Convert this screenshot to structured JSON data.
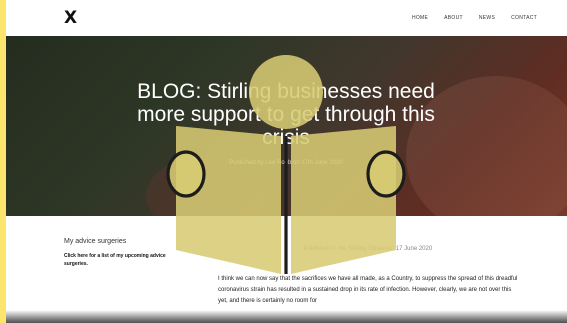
{
  "header": {
    "logo_text": "X",
    "nav": [
      "HOME",
      "ABOUT",
      "NEWS",
      "CONTACT"
    ]
  },
  "hero": {
    "title": "BLOG: Stirling businesses need more support to get through this crisis",
    "meta": "Published by Lee Robb on 17th June 2020"
  },
  "sidebar": {
    "heading": "My advice surgeries",
    "link": "Click here for a list of my upcoming advice surgeries."
  },
  "article": {
    "source": "Published in the Stirling Observer, 17 June 2020",
    "body": "I think we can now say that the sacrifices we have all made, as a Country, to suppress the spread of this dreadful coronavirus strain has resulted in a sustained drop in its rate of infection. However, clearly, we are not over this yet, and there is certainly no room for"
  },
  "overlay": {
    "icon": "reader-icon",
    "color": "#d7cb73"
  },
  "colors": {
    "frame": "#fbe56c",
    "top_right": "#2c2c2c"
  }
}
